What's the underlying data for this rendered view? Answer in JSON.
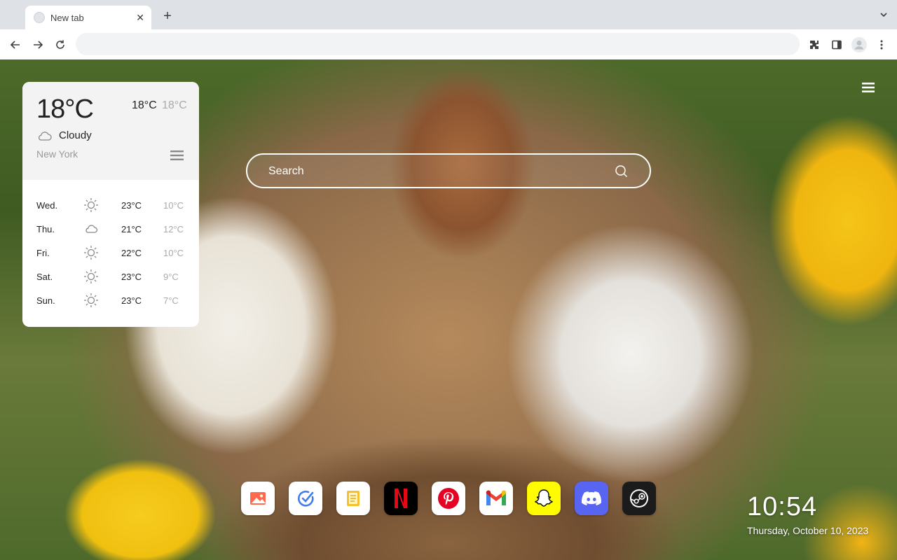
{
  "browser": {
    "tab_title": "New tab",
    "omnibox_value": ""
  },
  "weather": {
    "current_temp": "18°C",
    "high": "18°C",
    "low": "18°C",
    "condition": "Cloudy",
    "city": "New York",
    "forecast": [
      {
        "day": "Wed.",
        "icon": "sun-icon",
        "high": "23°C",
        "low": "10°C"
      },
      {
        "day": "Thu.",
        "icon": "cloud-icon",
        "high": "21°C",
        "low": "12°C"
      },
      {
        "day": "Fri.",
        "icon": "sun-icon",
        "high": "22°C",
        "low": "10°C"
      },
      {
        "day": "Sat.",
        "icon": "sun-icon",
        "high": "23°C",
        "low": "9°C"
      },
      {
        "day": "Sun.",
        "icon": "sun-icon",
        "high": "23°C",
        "low": "7°C"
      }
    ]
  },
  "search": {
    "placeholder": "Search"
  },
  "dock": [
    {
      "name": "photos-app",
      "icon": "image-icon",
      "bg": "#ffffff"
    },
    {
      "name": "tasks-app",
      "icon": "check-circle-icon",
      "bg": "#ffffff"
    },
    {
      "name": "notes-app",
      "icon": "note-icon",
      "bg": "#ffffff"
    },
    {
      "name": "netflix-app",
      "icon": "netflix-icon",
      "bg": "#000000"
    },
    {
      "name": "pinterest-app",
      "icon": "pinterest-icon",
      "bg": "#ffffff"
    },
    {
      "name": "gmail-app",
      "icon": "gmail-icon",
      "bg": "#ffffff"
    },
    {
      "name": "snapchat-app",
      "icon": "snapchat-icon",
      "bg": "#fffc00"
    },
    {
      "name": "discord-app",
      "icon": "discord-icon",
      "bg": "#5865f2"
    },
    {
      "name": "steam-app",
      "icon": "steam-icon",
      "bg": "#1b1b1b"
    }
  ],
  "clock": {
    "time": "10:54",
    "date": "Thursday, October 10, 2023"
  }
}
